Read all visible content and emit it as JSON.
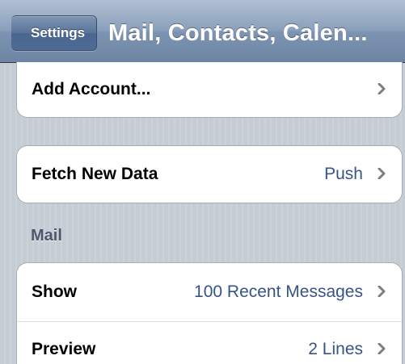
{
  "navbar": {
    "back_label": "Settings",
    "title": "Mail, Contacts, Calen..."
  },
  "groups": {
    "accounts": {
      "add_account_label": "Add Account..."
    },
    "fetch": {
      "label": "Fetch New Data",
      "value": "Push"
    }
  },
  "mail_section": {
    "header": "Mail",
    "rows": [
      {
        "label": "Show",
        "value": "100 Recent Messages"
      },
      {
        "label": "Preview",
        "value": "2 Lines"
      }
    ]
  },
  "colors": {
    "value_text": "#385487",
    "section_header": "#4c566c",
    "background": "#c5ccd4",
    "navbar": "#7d93b2"
  },
  "icons": {
    "chevron": "chevron-right-icon"
  }
}
